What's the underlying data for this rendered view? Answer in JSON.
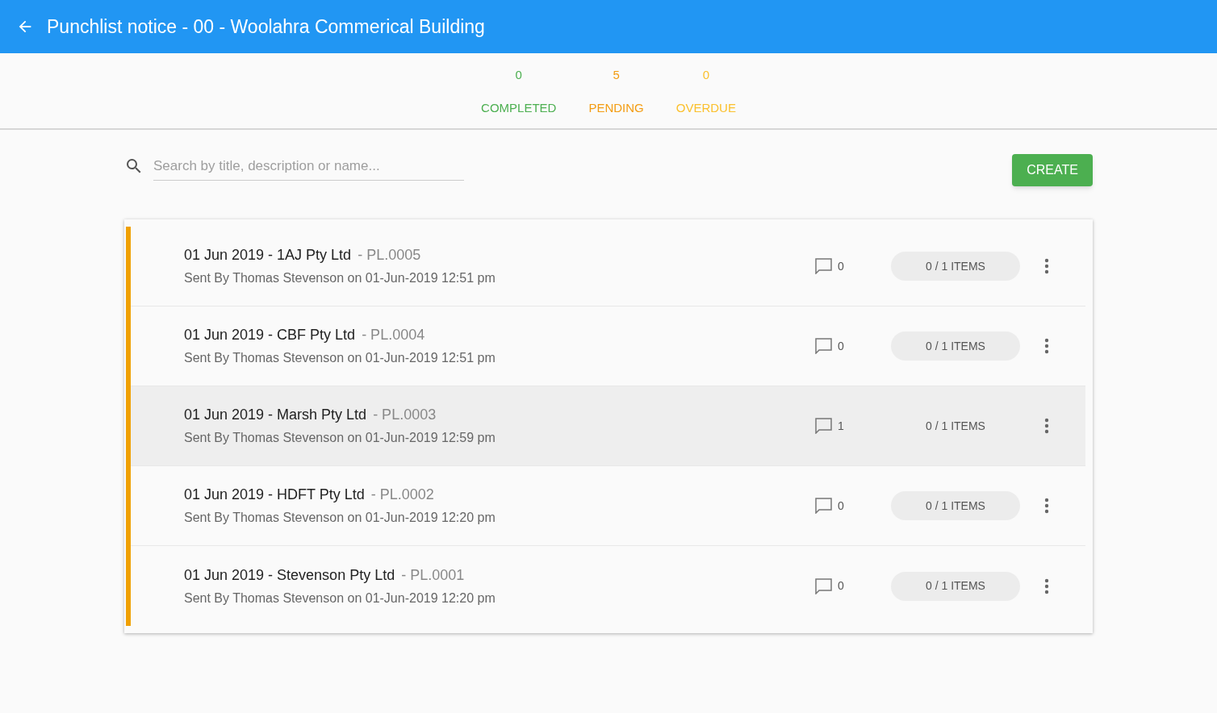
{
  "header": {
    "title": "Punchlist notice - 00 - Woolahra Commerical Building"
  },
  "stats": [
    {
      "count": "0",
      "label": "COMPLETED",
      "color": "#4caf50"
    },
    {
      "count": "5",
      "label": "PENDING",
      "color": "#f39c12"
    },
    {
      "count": "0",
      "label": "OVERDUE",
      "color": "#fbc02d"
    }
  ],
  "search": {
    "placeholder": "Search by title, description or name..."
  },
  "create_button": "CREATE",
  "rows": [
    {
      "title": "01 Jun 2019 - 1AJ Pty Ltd",
      "code": "- PL.0005",
      "subtitle": "Sent By Thomas Stevenson on 01-Jun-2019 12:51 pm",
      "comments": "0",
      "items": "0 / 1 ITEMS",
      "selected": false
    },
    {
      "title": "01 Jun 2019 - CBF Pty Ltd",
      "code": "- PL.0004",
      "subtitle": "Sent By Thomas Stevenson on 01-Jun-2019 12:51 pm",
      "comments": "0",
      "items": "0 / 1 ITEMS",
      "selected": false
    },
    {
      "title": "01 Jun 2019 - Marsh Pty Ltd",
      "code": "- PL.0003",
      "subtitle": "Sent By Thomas Stevenson on 01-Jun-2019 12:59 pm",
      "comments": "1",
      "items": "0 / 1 ITEMS",
      "selected": true
    },
    {
      "title": "01 Jun 2019 - HDFT Pty Ltd",
      "code": "- PL.0002",
      "subtitle": "Sent By Thomas Stevenson on 01-Jun-2019 12:20 pm",
      "comments": "0",
      "items": "0 / 1 ITEMS",
      "selected": false
    },
    {
      "title": "01 Jun 2019 - Stevenson Pty Ltd",
      "code": "- PL.0001",
      "subtitle": "Sent By Thomas Stevenson on 01-Jun-2019 12:20 pm",
      "comments": "0",
      "items": "0 / 1 ITEMS",
      "selected": false
    }
  ]
}
